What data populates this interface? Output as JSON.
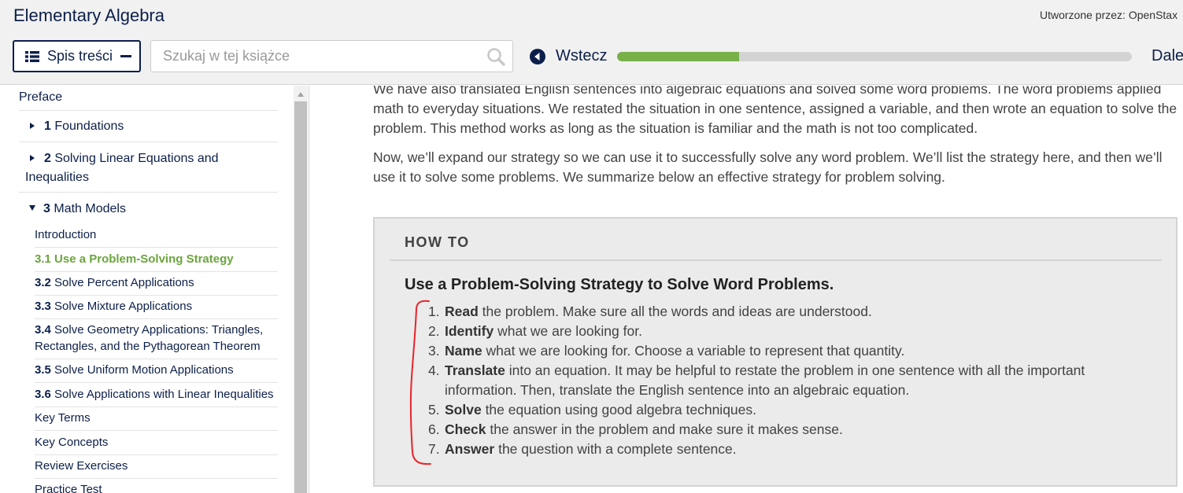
{
  "header": {
    "book_title": "Elementary Algebra",
    "author_text": "Utworzone przez: OpenStax",
    "toc_button_label": "Spis treści",
    "search_placeholder": "Szukaj w tej książce",
    "back_label": "Wstecz",
    "next_label": "Dalej",
    "progress_fraction": 0.237
  },
  "toc": {
    "items": [
      {
        "label": "Preface"
      },
      {
        "num": "1",
        "label": "Foundations"
      },
      {
        "num": "2",
        "label": "Solving Linear Equations and Inequalities"
      },
      {
        "num": "3",
        "label": "Math Models"
      }
    ],
    "chapter3_sections": [
      {
        "num": "",
        "label": "Introduction"
      },
      {
        "num": "3.1",
        "label": "Use a Problem-Solving Strategy"
      },
      {
        "num": "3.2",
        "label": "Solve Percent Applications"
      },
      {
        "num": "3.3",
        "label": "Solve Mixture Applications"
      },
      {
        "num": "3.4",
        "label": "Solve Geometry Applications: Triangles, Rectangles, and the Pythagorean Theorem"
      },
      {
        "num": "3.5",
        "label": "Solve Uniform Motion Applications"
      },
      {
        "num": "3.6",
        "label": "Solve Applications with Linear Inequalities"
      },
      {
        "num": "",
        "label": "Key Terms"
      },
      {
        "num": "",
        "label": "Key Concepts"
      },
      {
        "num": "",
        "label": "Review Exercises"
      },
      {
        "num": "",
        "label": "Practice Test"
      }
    ]
  },
  "content": {
    "para1": "We have also translated English sentences into algebraic equations and solved some word problems. The word problems applied math to everyday situations. We restated the situation in one sentence, assigned a variable, and then wrote an equation to solve the problem. This method works as long as the situation is familiar and the math is not too complicated.",
    "para2": "Now, we’ll expand our strategy so we can use it to successfully solve any word problem. We’ll list the strategy here, and then we’ll use it to solve some problems. We summarize below an effective strategy for problem solving.",
    "howto": {
      "label": "HOW TO",
      "title": "Use a Problem-Solving Strategy to Solve Word Problems.",
      "steps": [
        {
          "n": "1.",
          "keyword": "Read",
          "text": " the problem. Make sure all the words and ideas are understood."
        },
        {
          "n": "2.",
          "keyword": "Identify",
          "text": " what we are looking for."
        },
        {
          "n": "3.",
          "keyword": "Name",
          "text": " what we are looking for. Choose a variable to represent that quantity."
        },
        {
          "n": "4.",
          "keyword": "Translate",
          "text": " into an equation. It may be helpful to restate the problem in one sentence with all the important information. Then, translate the English sentence into an algebraic equation."
        },
        {
          "n": "5.",
          "keyword": "Solve",
          "text": " the equation using good algebra techniques."
        },
        {
          "n": "6.",
          "keyword": "Check",
          "text": " the answer in the problem and make sure it makes sense."
        },
        {
          "n": "7.",
          "keyword": "Answer",
          "text": " the question with a complete sentence."
        }
      ]
    }
  },
  "colors": {
    "navy": "#0c1f4a",
    "active_green": "#6ba53c",
    "progress_green": "#78b04a",
    "annotation_red": "#e8232a"
  }
}
